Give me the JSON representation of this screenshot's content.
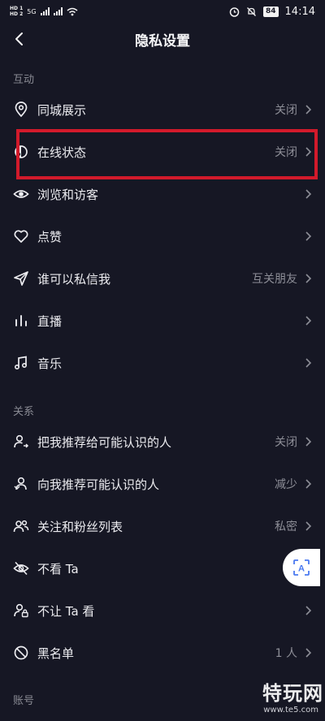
{
  "status_bar": {
    "hd1": "HD 1",
    "hd2": "HD 2",
    "network": "5G",
    "battery": "84",
    "time": "14:14"
  },
  "nav": {
    "title": "隐私设置"
  },
  "sections": {
    "interaction": "互动",
    "relations": "关系",
    "account": "账号"
  },
  "rows": [
    {
      "label": "同城展示",
      "value": "关闭",
      "icon": "location-pin-icon"
    },
    {
      "label": "在线状态",
      "value": "关闭",
      "icon": "online-status-icon"
    },
    {
      "label": "浏览和访客",
      "value": "",
      "icon": "eye-icon"
    },
    {
      "label": "点赞",
      "value": "",
      "icon": "heart-icon"
    },
    {
      "label": "谁可以私信我",
      "value": "互关朋友",
      "icon": "send-icon"
    },
    {
      "label": "直播",
      "value": "",
      "icon": "bars-icon"
    },
    {
      "label": "音乐",
      "value": "",
      "icon": "music-note-icon"
    },
    {
      "label": "把我推荐给可能认识的人",
      "value": "关闭",
      "icon": "user-share-icon"
    },
    {
      "label": "向我推荐可能认识的人",
      "value": "减少",
      "icon": "user-recommend-icon"
    },
    {
      "label": "关注和粉丝列表",
      "value": "私密",
      "icon": "users-icon"
    },
    {
      "label": "不看 Ta",
      "value": "",
      "icon": "eye-off-icon"
    },
    {
      "label": "不让 Ta 看",
      "value": "",
      "icon": "user-lock-icon"
    },
    {
      "label": "黑名单",
      "value": "1 人",
      "icon": "block-icon"
    }
  ],
  "float_button": {
    "glyph": "A"
  },
  "watermark": {
    "main": "特玩网",
    "url": "www.te5.com"
  },
  "colors": {
    "background": "#161724",
    "highlight": "#d21a2b",
    "muted": "#8d8e97"
  }
}
